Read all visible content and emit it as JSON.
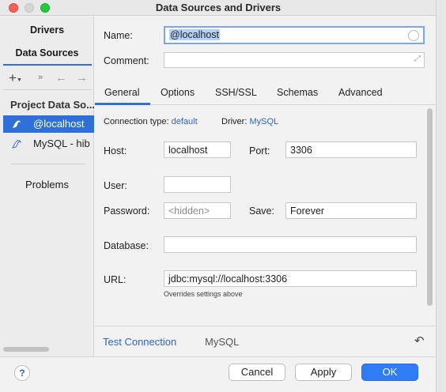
{
  "window": {
    "title": "Data Sources and Drivers"
  },
  "sidebar": {
    "tabs": [
      "Drivers",
      "Data Sources"
    ],
    "toolbar": {
      "add": "+",
      "more": "»",
      "back": "←",
      "forward": "→"
    },
    "group_label": "Project Data So...",
    "items": [
      {
        "label": "@localhost",
        "selected": true
      },
      {
        "label": "MySQL - hib"
      }
    ],
    "problems": "Problems"
  },
  "form": {
    "name_label": "Name:",
    "name_value": "@localhost",
    "comment_label": "Comment:",
    "comment_value": ""
  },
  "tabs": [
    "General",
    "Options",
    "SSH/SSL",
    "Schemas",
    "Advanced"
  ],
  "general": {
    "connection_type_label": "Connection type:",
    "connection_type_value": "default",
    "driver_label": "Driver:",
    "driver_value": "MySQL",
    "host_label": "Host:",
    "host_value": "localhost",
    "port_label": "Port:",
    "port_value": "3306",
    "user_label": "User:",
    "user_value": "",
    "password_label": "Password:",
    "password_placeholder": "<hidden>",
    "save_label": "Save:",
    "save_value": "Forever",
    "database_label": "Database:",
    "database_value": "",
    "url_label": "URL:",
    "url_value": "jdbc:mysql://localhost:3306",
    "url_hint": "Overrides settings above"
  },
  "footer": {
    "test_connection": "Test Connection",
    "driver_name": "MySQL"
  },
  "buttons": {
    "help": "?",
    "cancel": "Cancel",
    "apply": "Apply",
    "ok": "OK"
  },
  "colors": {
    "accent": "#2f6fd8",
    "ok_button": "#2f7cf6",
    "link": "#2a65c8"
  }
}
